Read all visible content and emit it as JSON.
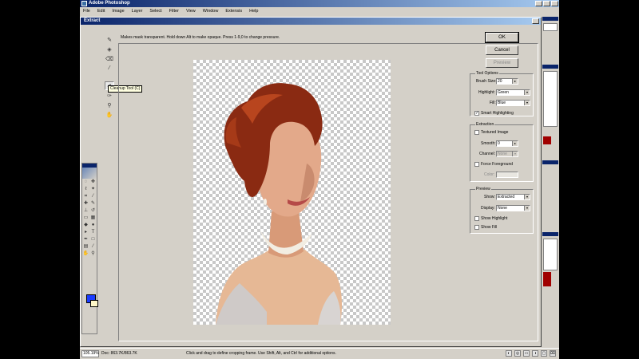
{
  "app": {
    "title": "Adobe Photoshop",
    "menu": [
      "File",
      "Edit",
      "Image",
      "Layer",
      "Select",
      "Filter",
      "View",
      "Window",
      "Extensis",
      "Help"
    ]
  },
  "dialog": {
    "title": "Extract",
    "instruction": "Makes mask transparent. Hold down Alt to make opaque. Press 1-9,0 to change pressure.",
    "tooltip": "Cleanup Tool (C)",
    "tools": [
      {
        "name": "edge-highlighter-tool",
        "glyph": "✎"
      },
      {
        "name": "fill-tool",
        "glyph": "◈"
      },
      {
        "name": "eraser-tool",
        "glyph": "⌫"
      },
      {
        "name": "eyedropper-tool",
        "glyph": "⁄"
      },
      {
        "name": "cleanup-tool",
        "glyph": "✐"
      },
      {
        "name": "edge-touchup-tool",
        "glyph": "✑"
      },
      {
        "name": "zoom-tool",
        "glyph": "⚲"
      },
      {
        "name": "hand-tool",
        "glyph": "✋"
      }
    ],
    "buttons": {
      "ok": "OK",
      "cancel": "Cancel",
      "preview": "Preview"
    },
    "tool_options": {
      "label": "Tool Options",
      "brush_size_label": "Brush Size:",
      "brush_size_value": "20",
      "highlight_label": "Highlight:",
      "highlight_value": "Green",
      "fill_label": "Fill:",
      "fill_value": "Blue",
      "smart_highlighting_label": "Smart Highlighting",
      "smart_highlighting_checked": true
    },
    "extraction": {
      "label": "Extraction",
      "textured_image_label": "Textured Image",
      "smooth_label": "Smooth:",
      "smooth_value": "0",
      "channel_label": "Channel:",
      "channel_value": "None",
      "force_foreground_label": "Force Foreground",
      "color_label": "Color:"
    },
    "preview": {
      "label": "Preview",
      "show_label": "Show:",
      "show_value": "Extracted",
      "display_label": "Display:",
      "display_value": "None",
      "show_highlight_label": "Show Highlight",
      "show_fill_label": "Show Fill"
    }
  },
  "status": {
    "zoom": "105.19%",
    "doc": "Doc: 863.7K/863.7K",
    "hint": "Click and drag to define cropping frame. Use Shift, Alt, and Ctrl for additional options."
  },
  "colors": {
    "title_bar": "#0a246a",
    "foreground": "#1a3cff",
    "background": "#fff8c8"
  }
}
